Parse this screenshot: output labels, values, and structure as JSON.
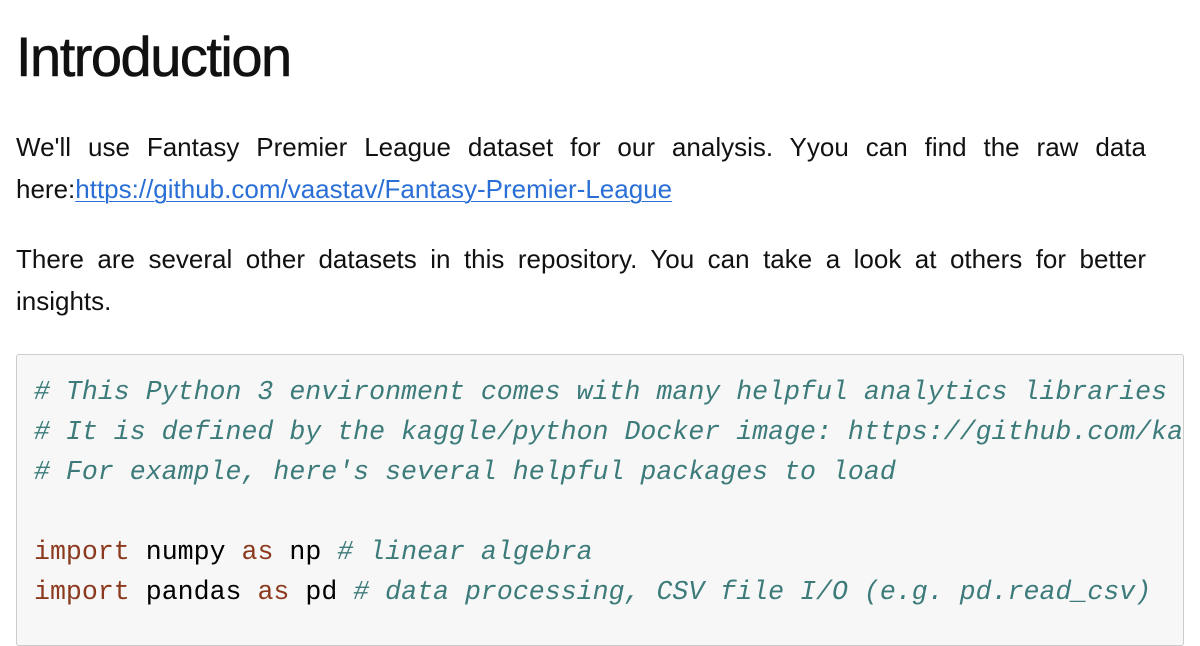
{
  "page": {
    "heading": "Introduction",
    "paragraphs": [
      {
        "text_before_link": "We'll use Fantasy Premier League dataset for our analysis. Yyou can find the raw data here:",
        "link_text": "https://github.com/vaastav/Fantasy-Premier-League"
      },
      {
        "text": "There are several other datasets in this repository. You can take a look at others for better insights."
      }
    ]
  },
  "colors": {
    "link": "#2a6fd6",
    "code_background": "#f7f7f7",
    "code_border": "#cccccc",
    "code_comment": "#3d7b7b",
    "code_keyword": "#8b3a1e"
  },
  "code": {
    "language": "python",
    "lines": [
      {
        "comment": "# This Python 3 environment comes with many helpful analytics libraries installed"
      },
      {
        "comment": "# It is defined by the kaggle/python Docker image: https://github.com/kaggle/docker-python"
      },
      {
        "comment": "# For example, here's several helpful packages to load"
      },
      {
        "blank": ""
      },
      {
        "kw1": "import",
        "name1": "numpy",
        "kw2": "as",
        "name2": "np",
        "comment": "# linear algebra"
      },
      {
        "kw1": "import",
        "name1": "pandas",
        "kw2": "as",
        "name2": "pd",
        "comment": "# data processing, CSV file I/O (e.g. pd.read_csv)"
      }
    ]
  }
}
